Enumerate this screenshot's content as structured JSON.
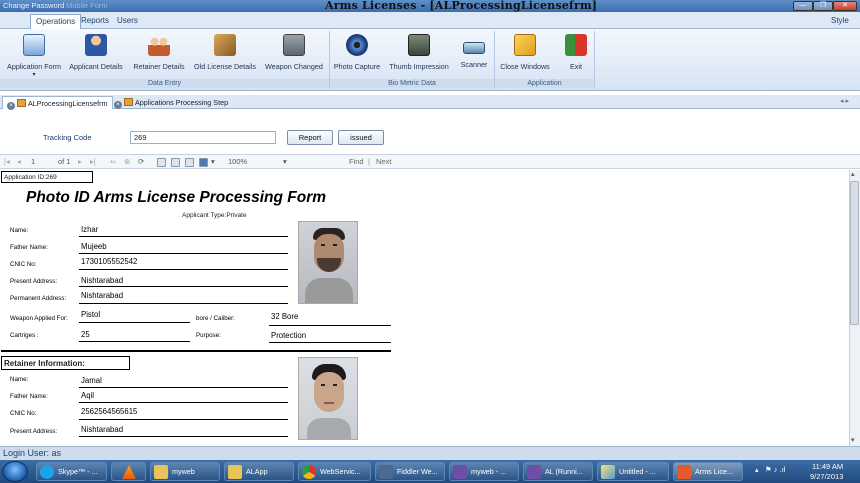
{
  "window": {
    "quick_access": "Change Password",
    "quick_access_extra": "Mobile Form",
    "title": "Arms Licenses - [ALProcessingLicensefrm]",
    "style_menu": "Style"
  },
  "menu": {
    "tabs": [
      "Operations",
      "Reports",
      "Users"
    ]
  },
  "ribbon": {
    "groups": {
      "data_entry": "Data Entry",
      "bio_metric": "Bio Metric Data",
      "application": "Application"
    },
    "buttons": {
      "application_form": "Application Form",
      "applicant_details": "Applicant Details",
      "retainer_details": "Retainer Details",
      "old_license_details": "Old License Details",
      "weapon_changed": "Weapon Changed",
      "photo_capture": "Photo Capture",
      "thumb_impression": "Thumb Impression",
      "scanner": "Scanner",
      "close_windows": "Close Windows",
      "exit": "Exit"
    }
  },
  "doc_tabs": [
    "ALProcessingLicensefrm",
    "Applications Processing Step"
  ],
  "params": {
    "tracking_label": "Tracking Code",
    "tracking_value": "269",
    "report_button": "Report",
    "issued_button": "issued"
  },
  "viewer_toolbar": {
    "page_current": "1",
    "page_of": "of 1",
    "zoom": "100%",
    "find": "Find",
    "next": "Next"
  },
  "report": {
    "application_id": "Application ID:269",
    "title": "Photo ID Arms License Processing Form",
    "applicant_type": "Applicant Type:Private",
    "applicant": {
      "name_label": "Name:",
      "name": "Izhar",
      "father_label": "Father Name:",
      "father": "Mujeeb",
      "cnic_label": "CNIC No:",
      "cnic": "1730105552542",
      "present_label": "Present Address:",
      "present": "Nishtarabad",
      "permanent_label": "Permanent Address:",
      "permanent": "Nishtarabad",
      "weapon_label": "Weapon Applied For:",
      "weapon": "Pistol",
      "bore_label": "bore / Caliber:",
      "bore": "32 Bore",
      "cartriges_label": "Cartriges :",
      "cartriges": "25",
      "purpose_label": "Purpose:",
      "purpose": "Protection"
    },
    "retainer_header": "Retainer Information:",
    "retainer": {
      "name_label": "Name:",
      "name": "Jamal",
      "father_label": "Father Name:",
      "father": "Aqil",
      "cnic_label": "CNIC No:",
      "cnic": "2562564565615",
      "present_label": "Present Address:",
      "present": "Nishtarabad"
    }
  },
  "status": {
    "login": "Login User: as"
  },
  "taskbar": {
    "items": [
      "Skype™ - ...",
      "",
      "myweb",
      "ALApp",
      "WebServic...",
      "Fiddler We...",
      "myweb - ...",
      "AL (Runni...",
      "Untitled - ...",
      "Arms Lice..."
    ],
    "time": "11:49 AM",
    "date": "9/27/2013"
  },
  "colors": {
    "accent": "#3a6db0",
    "ribbon": "#d6e3f3",
    "taskbar": "#1f4a7d"
  }
}
